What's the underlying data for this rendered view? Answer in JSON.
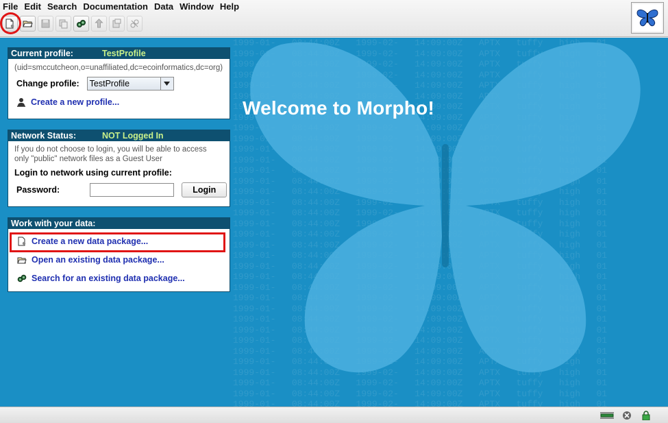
{
  "menu": [
    "File",
    "Edit",
    "Search",
    "Documentation",
    "Data",
    "Window",
    "Help"
  ],
  "toolbar": {
    "buttons": [
      {
        "name": "new-data-package-icon",
        "enabled": true
      },
      {
        "name": "open-package-icon",
        "enabled": true
      },
      {
        "name": "save-icon",
        "enabled": false
      },
      {
        "name": "copy-icon",
        "enabled": false
      },
      {
        "name": "search-icon",
        "enabled": true
      },
      {
        "name": "upload-icon",
        "enabled": false
      },
      {
        "name": "export-icon",
        "enabled": false
      },
      {
        "name": "delete-icon",
        "enabled": false
      }
    ]
  },
  "welcome": "Welcome to Morpho!",
  "profile_panel": {
    "heading": "Current profile:",
    "profile_name": "TestProfile",
    "dn": "(uid=smccutcheon,o=unaffiliated,dc=ecoinformatics,dc=org)",
    "change_label": "Change profile:",
    "selected_profile": "TestProfile",
    "create_link": "Create a new profile..."
  },
  "network_panel": {
    "heading": "Network Status:",
    "status": "NOT Logged In",
    "note": "If you do not choose to login, you will be able to access only \"public\" network files as a Guest User",
    "login_prompt": "Login to network using current profile:",
    "password_label": "Password:",
    "password_value": "",
    "login_button": "Login"
  },
  "data_panel": {
    "heading": "Work with your data:",
    "links": [
      "Create a new data package...",
      "Open an existing data package...",
      "Search for an existing data package..."
    ]
  },
  "colors": {
    "background": "#1a8fc5",
    "panel_header": "#0e5070",
    "status_text": "#c9f08a",
    "link": "#1f2fb0",
    "highlight": "#e01515"
  }
}
